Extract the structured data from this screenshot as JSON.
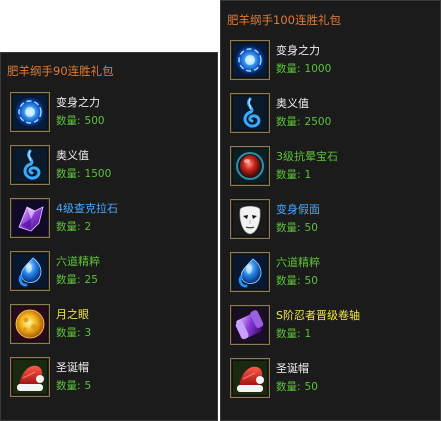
{
  "colors": {
    "panel_bg": "#1b1b1b",
    "title_orange": "#e07a36",
    "name_white": "#f0f0f0",
    "name_blue": "#4aa8ff",
    "name_green": "#5cc23a",
    "name_yellow": "#f2e64a",
    "quantity_green": "#5cc23a"
  },
  "quantity_label": "数量",
  "quantity_sep": ":",
  "left_panel": {
    "title": "肥羊纲手90连胜礼包",
    "items": [
      {
        "name": "变身之力",
        "quantity": "500",
        "name_color": "#f0f0f0",
        "icon": "blue-orb-icon"
      },
      {
        "name": "奥义值",
        "quantity": "1500",
        "name_color": "#f0f0f0",
        "icon": "blue-swirl-icon"
      },
      {
        "name": "4级查克拉石",
        "quantity": "2",
        "name_color": "#4aa8ff",
        "icon": "purple-crystal-icon"
      },
      {
        "name": "六道精粹",
        "quantity": "25",
        "name_color": "#5cc23a",
        "icon": "blue-droplet-icon"
      },
      {
        "name": "月之眼",
        "quantity": "3",
        "name_color": "#f2e64a",
        "icon": "moon-eye-icon"
      },
      {
        "name": "圣诞帽",
        "quantity": "5",
        "name_color": "#f0f0f0",
        "icon": "santa-hat-icon"
      }
    ]
  },
  "right_panel": {
    "title": "肥羊纲手100连胜礼包",
    "items": [
      {
        "name": "变身之力",
        "quantity": "1000",
        "name_color": "#f0f0f0",
        "icon": "blue-orb-icon"
      },
      {
        "name": "奥义值",
        "quantity": "2500",
        "name_color": "#f0f0f0",
        "icon": "blue-swirl-icon"
      },
      {
        "name": "3级抗晕宝石",
        "quantity": "1",
        "name_color": "#5cc23a",
        "icon": "red-gem-icon"
      },
      {
        "name": "变身假面",
        "quantity": "50",
        "name_color": "#4aa8ff",
        "icon": "white-mask-icon"
      },
      {
        "name": "六道精粹",
        "quantity": "50",
        "name_color": "#5cc23a",
        "icon": "blue-droplet-icon"
      },
      {
        "name": "S阶忍者晋级卷轴",
        "quantity": "1",
        "name_color": "#f2e64a",
        "icon": "purple-scroll-icon"
      },
      {
        "name": "圣诞帽",
        "quantity": "50",
        "name_color": "#f0f0f0",
        "icon": "santa-hat-icon"
      }
    ]
  }
}
